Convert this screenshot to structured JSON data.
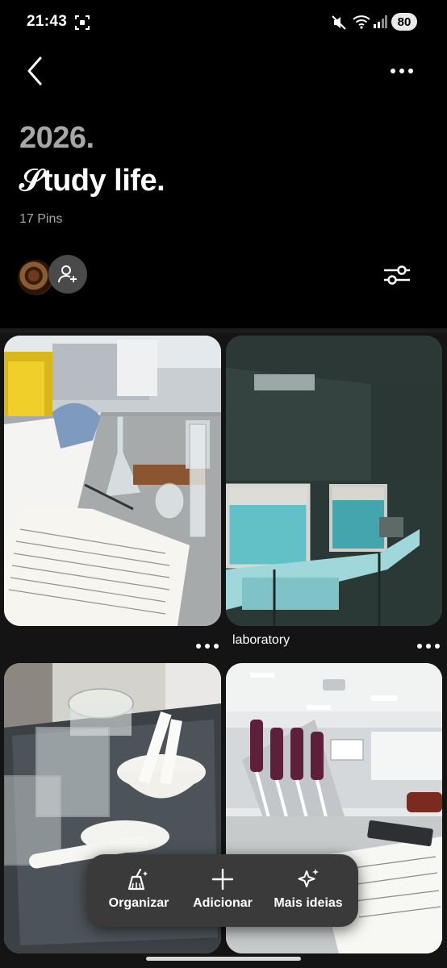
{
  "status_bar": {
    "time": "21:43",
    "battery": "80",
    "icons": [
      "screenshot-icon",
      "mute-icon",
      "wifi-icon",
      "signal-icon"
    ]
  },
  "header": {
    "back_icon": "chevron-left-icon",
    "more_icon": "more-horizontal-icon"
  },
  "board": {
    "year": "2026.",
    "title": "𝒮tudy life.",
    "pin_count": "17 Pins"
  },
  "collaborators": {
    "add_icon": "add-person-icon",
    "filter_icon": "sliders-icon"
  },
  "pins": [
    {
      "title": "",
      "has_more": true
    },
    {
      "title": "laboratory",
      "has_more": true
    },
    {
      "title": "",
      "has_more": false
    },
    {
      "title": "",
      "has_more": false
    }
  ],
  "actions": [
    {
      "label": "Organizar",
      "icon": "broom-icon"
    },
    {
      "label": "Adicionar",
      "icon": "plus-icon"
    },
    {
      "label": "Mais ideias",
      "icon": "sparkles-icon"
    }
  ],
  "colors": {
    "background": "#000000",
    "year_grey": "#a7a7a7",
    "action_bar": "#3a3a3a"
  }
}
